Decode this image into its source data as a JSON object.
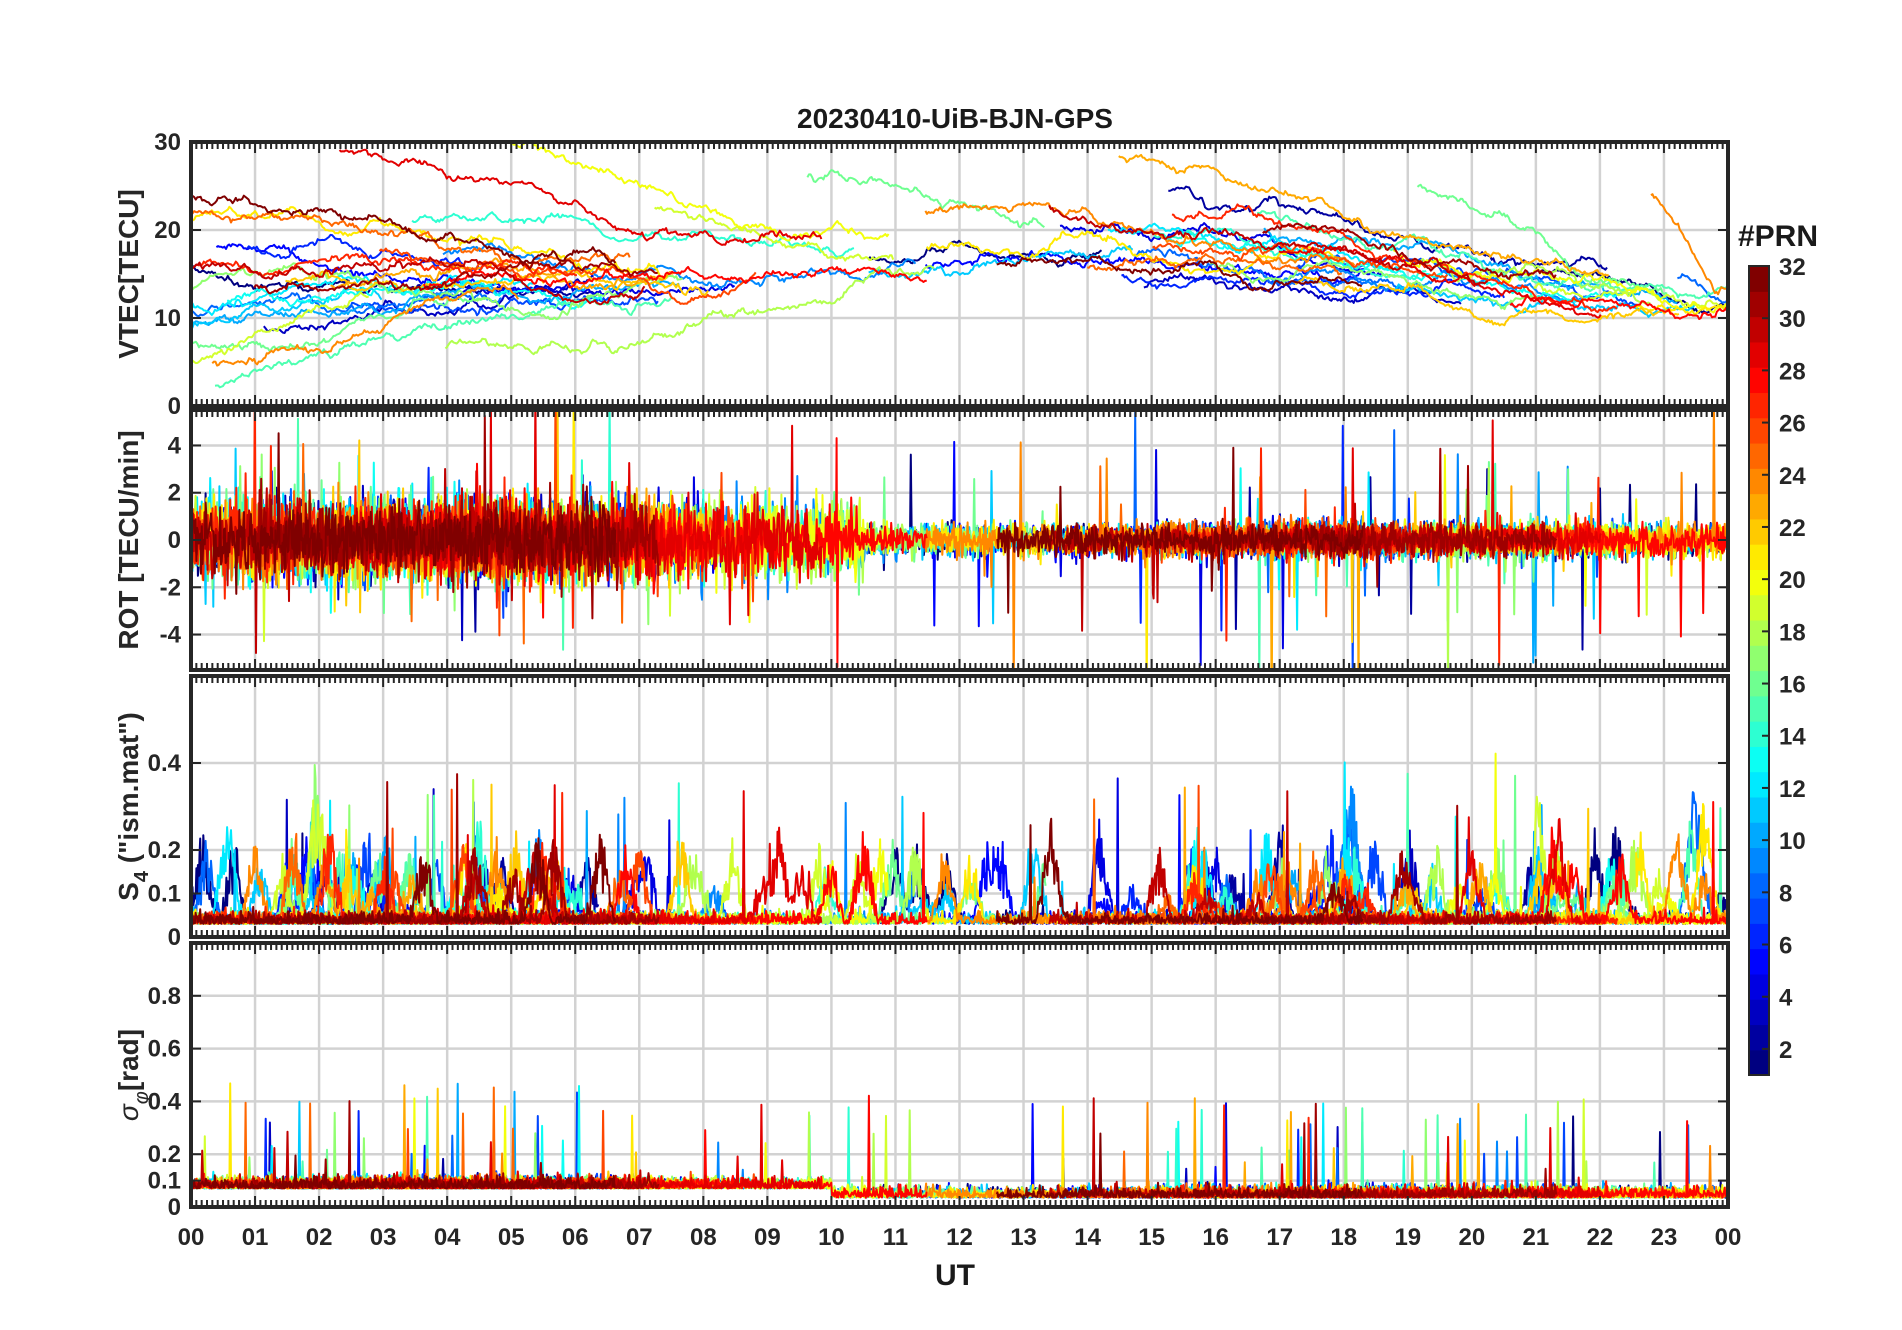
{
  "title": "20230410-UiB-BJN-GPS",
  "xlabel": "UT",
  "colorbar": {
    "label": "#PRN",
    "range": [
      1,
      32
    ],
    "ticks": [
      2,
      4,
      6,
      8,
      10,
      12,
      14,
      16,
      18,
      20,
      22,
      24,
      26,
      28,
      30,
      32
    ],
    "colormap": "jet"
  },
  "chart_data": [
    {
      "type": "line",
      "ylabel": "VTEC[TECU]",
      "xlim": [
        0,
        24
      ],
      "ylim": [
        0,
        30
      ],
      "yticks": [
        0,
        10,
        20,
        30
      ],
      "grid": true,
      "series_by": "PRN 1-32",
      "approx_values": {
        "typical_range": [
          8,
          22
        ],
        "morning_level": 12,
        "midday_level": 17,
        "evening_level": 11,
        "max": 29
      }
    },
    {
      "type": "line",
      "ylabel": "ROT [TECU/min]",
      "xlim": [
        0,
        24
      ],
      "ylim": [
        -5.5,
        5.5
      ],
      "yticks": [
        -4,
        -2,
        0,
        2,
        4
      ],
      "grid": true,
      "series_by": "PRN 1-32",
      "approx_values": {
        "typical_range": [
          -1,
          1
        ],
        "max_spike": 5,
        "min_spike": -5.5
      }
    },
    {
      "type": "line",
      "ylabel": "S4 (\"ism.mat\")",
      "ylabel_main": "S",
      "ylabel_sub": "4",
      "ylabel_rest": " (\"ism.mat\")",
      "xlim": [
        0,
        24
      ],
      "ylim": [
        0,
        0.6
      ],
      "yticks": [
        0,
        0.1,
        0.2,
        0.4
      ],
      "grid": true,
      "series_by": "PRN 1-32",
      "approx_values": {
        "baseline": 0.03,
        "max_spike": 0.5
      }
    },
    {
      "type": "line",
      "ylabel": "σφ[rad]",
      "ylabel_main": "σ",
      "ylabel_sub": "φ",
      "ylabel_rest": "[rad]",
      "xlim": [
        0,
        24
      ],
      "ylim": [
        0,
        1
      ],
      "yticks": [
        0,
        0.1,
        0.2,
        0.4,
        0.6,
        0.8
      ],
      "grid": true,
      "series_by": "PRN 1-32",
      "approx_values": {
        "baseline": 0.04,
        "max_spike": 0.48
      }
    }
  ],
  "xticks": [
    "00",
    "01",
    "02",
    "03",
    "04",
    "05",
    "06",
    "07",
    "08",
    "09",
    "10",
    "11",
    "12",
    "13",
    "14",
    "15",
    "16",
    "17",
    "18",
    "19",
    "20",
    "21",
    "22",
    "23",
    "00"
  ]
}
